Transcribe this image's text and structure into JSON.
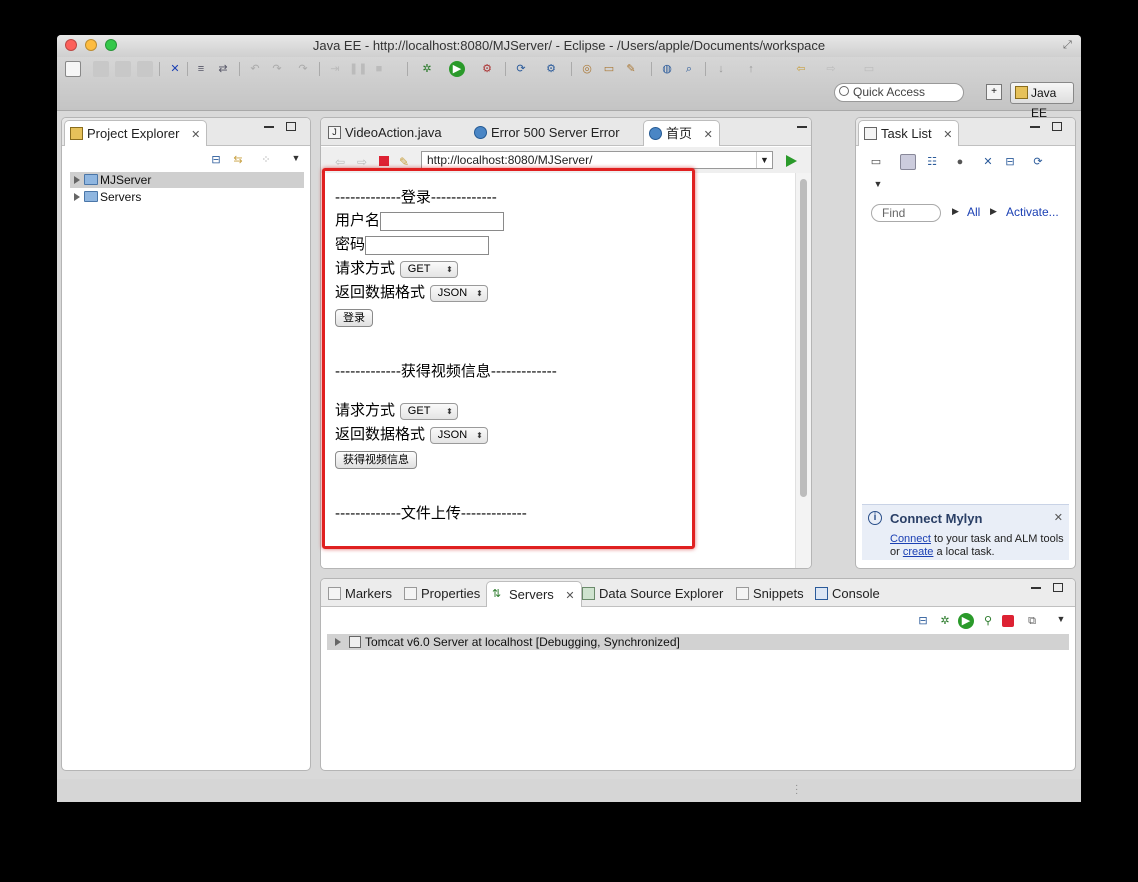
{
  "window": {
    "title": "Java EE - http://localhost:8080/MJServer/ - Eclipse - /Users/apple/Documents/workspace"
  },
  "toolbar": {
    "quick_access_placeholder": "Quick Access",
    "perspective_label": "Java EE"
  },
  "project_explorer": {
    "tab_label": "Project Explorer",
    "items": [
      {
        "label": "MJServer",
        "selected": true
      },
      {
        "label": "Servers",
        "selected": false
      }
    ]
  },
  "editor": {
    "tabs": [
      {
        "label": "VideoAction.java",
        "icon": "java-file-icon",
        "active": false
      },
      {
        "label": "Error 500 Server Error",
        "icon": "globe-icon",
        "active": false
      },
      {
        "label": "首页",
        "icon": "globe-icon",
        "active": true
      }
    ],
    "url": "http://localhost:8080/MJServer/",
    "page": {
      "login_heading": "-------------登录-------------",
      "username_label": "用户名",
      "password_label": "密码",
      "method_label": "请求方式",
      "method_value": "GET",
      "format_label": "返回数据格式",
      "format_value": "JSON",
      "login_button": "登录",
      "video_heading": "-------------获得视频信息-------------",
      "video_method_label": "请求方式",
      "video_method_value": "GET",
      "video_format_label": "返回数据格式",
      "video_format_value": "JSON",
      "video_button": "获得视频信息",
      "upload_heading": "-------------文件上传-------------"
    }
  },
  "task_list": {
    "tab_label": "Task List",
    "find_placeholder": "Find",
    "all_label": "All",
    "activate_label": "Activate...",
    "mylyn": {
      "title": "Connect Mylyn",
      "connect_link": "Connect",
      "text1": " to your task and ALM tools or ",
      "create_link": "create",
      "text2": " a local task."
    }
  },
  "bottom_panel": {
    "tabs": [
      {
        "label": "Markers",
        "active": false
      },
      {
        "label": "Properties",
        "active": false
      },
      {
        "label": "Servers",
        "active": true
      },
      {
        "label": "Data Source Explorer",
        "active": false
      },
      {
        "label": "Snippets",
        "active": false
      },
      {
        "label": "Console",
        "active": false
      }
    ],
    "server_row": "Tomcat v6.0 Server at localhost  [Debugging, Synchronized]"
  },
  "colors": {
    "highlight": "#e02020",
    "link": "#1a3fb3"
  }
}
